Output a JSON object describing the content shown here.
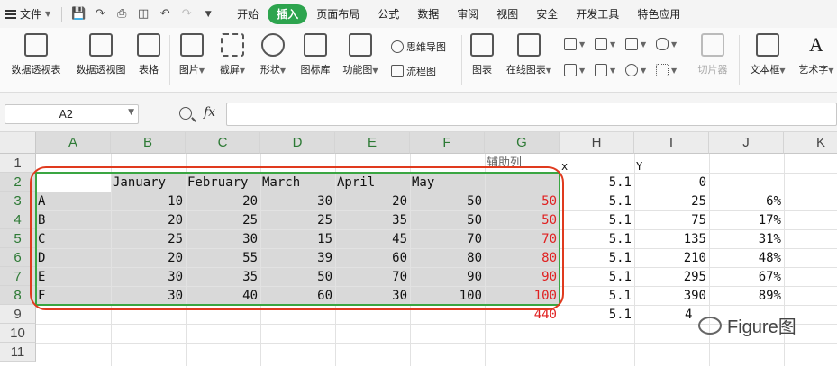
{
  "menubar": {
    "file_label": "文件",
    "tabs": [
      "开始",
      "插入",
      "页面布局",
      "公式",
      "数据",
      "审阅",
      "视图",
      "安全",
      "开发工具",
      "特色应用"
    ],
    "active_tab": "插入"
  },
  "ribbon": {
    "pivot_table": "数据透视表",
    "pivot_chart": "数据透视图",
    "table": "表格",
    "picture": "图片",
    "screenshot": "截屏",
    "shapes": "形状",
    "icon_lib": "图标库",
    "function_chart": "功能图",
    "mindmap": "思维导图",
    "flowchart": "流程图",
    "chart": "图表",
    "online_chart": "在线图表",
    "slicer": "切片器",
    "textbox": "文本框",
    "wordart": "艺术字"
  },
  "formula_bar": {
    "name_box": "A2",
    "fx_label": "fx",
    "formula": ""
  },
  "grid": {
    "columns": [
      "A",
      "B",
      "C",
      "D",
      "E",
      "F",
      "G",
      "H",
      "I",
      "J",
      "K"
    ],
    "rows": [
      "1",
      "2",
      "3",
      "4",
      "5",
      "6",
      "7",
      "8",
      "9",
      "10",
      "11"
    ],
    "g1_label": "辅助列",
    "h1": "x",
    "i1": "Y",
    "months": [
      "January",
      "February",
      "March",
      "April",
      "May"
    ],
    "data_rows": [
      {
        "label": "A",
        "values": [
          "10",
          "20",
          "30",
          "20",
          "50"
        ],
        "helper": "50",
        "x": "5.1",
        "y": "25",
        "pct": "6%"
      },
      {
        "label": "B",
        "values": [
          "20",
          "25",
          "25",
          "35",
          "50"
        ],
        "helper": "50",
        "x": "5.1",
        "y": "75",
        "pct": "17%"
      },
      {
        "label": "C",
        "values": [
          "25",
          "30",
          "15",
          "45",
          "70"
        ],
        "helper": "70",
        "x": "5.1",
        "y": "135",
        "pct": "31%"
      },
      {
        "label": "D",
        "values": [
          "20",
          "55",
          "39",
          "60",
          "80"
        ],
        "helper": "80",
        "x": "5.1",
        "y": "210",
        "pct": "48%"
      },
      {
        "label": "E",
        "values": [
          "30",
          "35",
          "50",
          "70",
          "90"
        ],
        "helper": "90",
        "x": "5.1",
        "y": "295",
        "pct": "67%"
      },
      {
        "label": "F",
        "values": [
          "30",
          "40",
          "60",
          "30",
          "100"
        ],
        "helper": "100",
        "x": "5.1",
        "y": "390",
        "pct": "89%"
      }
    ],
    "h2": "5.1",
    "i2": "0",
    "g9": "440",
    "h9": "5.1",
    "i9": "4"
  },
  "watermark": "Figure图",
  "colors": {
    "active_tab": "#2da44e",
    "red_text": "#e02020",
    "selection": "#3aa642",
    "oval": "#e03a1e"
  }
}
